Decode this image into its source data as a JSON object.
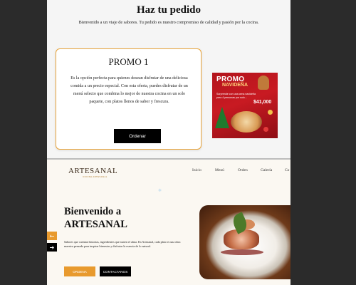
{
  "order": {
    "title": "Haz tu pedido",
    "subtitle": "Bienvenido a un viaje de sabores. Tu pedido es nuestro compromiso de calidad y pasión por la cocina."
  },
  "promo": {
    "title": "PROMO 1",
    "description": "Es la opción perfecta para quienes desean disfrutar de una deliciosa comida a un precio especial. Con esta oferta, puedes disfrutar de un menú selecto que combina lo mejor de nuestra cocina en un solo paquete, con platos llenos de sabor y frescura.",
    "button_label": "Ordenar",
    "image": {
      "title": "PROMO",
      "subtitle": "NAVIDEÑA",
      "note": "Sorprende con una cena navideña para 4 personas por solo...",
      "price": "$41,000"
    }
  },
  "landing": {
    "logo": "ARTESANAL",
    "logo_sub": "COCINA ARTESANAL",
    "nav": [
      "Inicio",
      "Menú",
      "Orden",
      "Galería",
      "Co"
    ],
    "hero_title_line1": "Bienvenido a",
    "hero_title_line2": "ARTESANAL",
    "hero_desc": "Sabores que cuentan historias, ingredientes que nutren el alma. En Artesanal, cada plato es una obra maestra pensada para inspirar bienestar y disfrutar la esencia de lo natural.",
    "btn_orden": "ORDENA",
    "btn_contact": "CONTACTANOS"
  },
  "widgets": {
    "up_arrow": "←",
    "next_arrow": "➔"
  },
  "colors": {
    "accent": "#e89a2e",
    "primary_button": "#000000",
    "page_background": "#2b2b2b"
  }
}
